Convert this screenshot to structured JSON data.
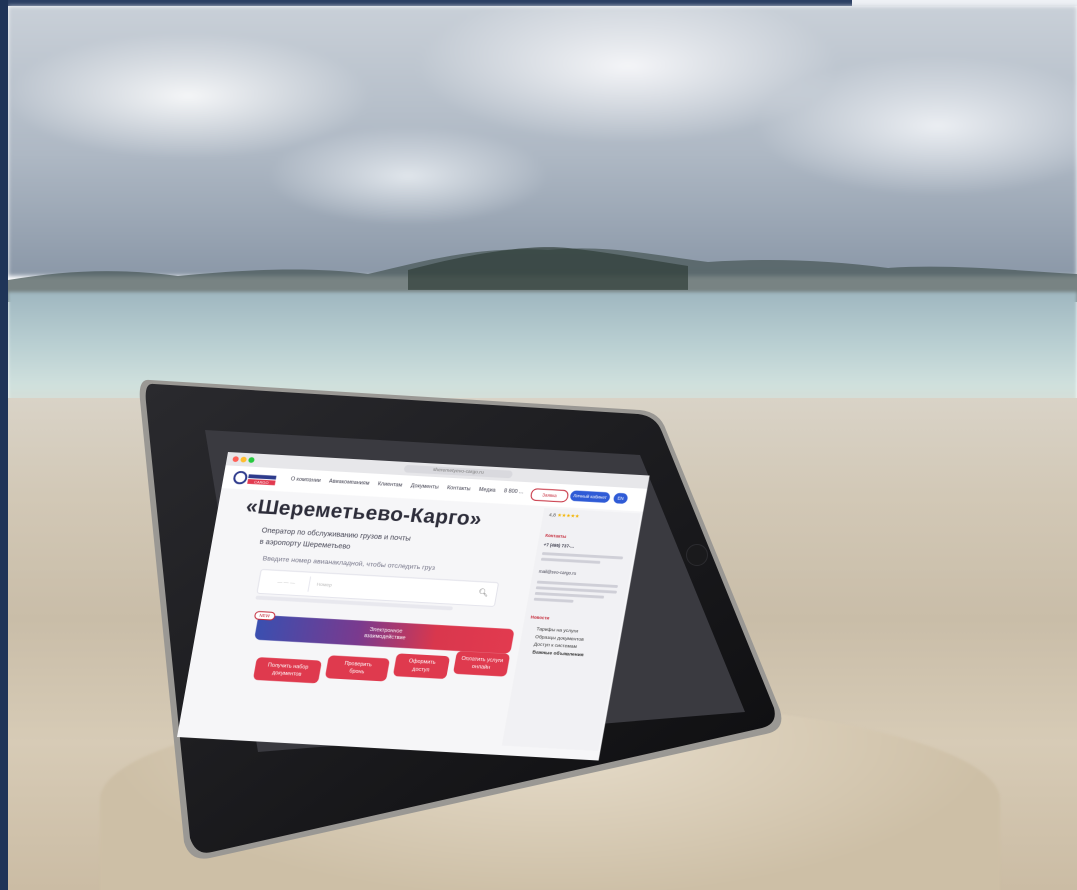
{
  "scene": {
    "kind": "photo",
    "colors": {
      "frame": "#2b3f63",
      "sky": "#aeb8c4",
      "sea": "#b9cfd2",
      "sand": "#d2c8b6",
      "tablet_bezel": "#141416",
      "accent_red": "#df3a4e",
      "accent_blue": "#2f5bd6"
    }
  },
  "tablet_screen": {
    "browser": {
      "url": "sheremetyevo-cargo.ru"
    },
    "nav": {
      "logo_text": "CARGO",
      "items": [
        "О компании",
        "Авиакомпаниям",
        "Клиентам",
        "Документы",
        "Контакты",
        "Медиа"
      ],
      "phone": "8 800 ...",
      "button_outline": "Заявка",
      "button_blue": "Личный кабинет",
      "lang": "EN"
    },
    "hero": {
      "title": "«Шереметьево-Карго»",
      "subtitle_line1": "Оператор по обслуживанию грузов и почты",
      "subtitle_line2": "в аэропорту Шереметьево",
      "track_label": "Введите номер авианакладной, чтобы отследить груз",
      "track_placeholder": "Номер"
    },
    "banner": {
      "badge": "NEW",
      "text_line1": "Электронное",
      "text_line2": "взаимодействие"
    },
    "actions": [
      {
        "label_line1": "Получить набор",
        "label_line2": "документов"
      },
      {
        "label_line1": "Проверить",
        "label_line2": "бронь"
      },
      {
        "label_line1": "Оформить",
        "label_line2": "доступ"
      },
      {
        "label_line1": "Оплатить услуги",
        "label_line2": "онлайн"
      }
    ],
    "sidebar": {
      "rating": "4,8",
      "stars": "★★★★★",
      "contacts_heading": "Контакты",
      "phone": "+7 (495) 737-...",
      "email": "mail@svo-cargo.ru",
      "news_heading": "Новости",
      "links": [
        "Тарифы на услуги",
        "Образцы документов",
        "Доступ к системам",
        "Важные объявления"
      ]
    }
  }
}
